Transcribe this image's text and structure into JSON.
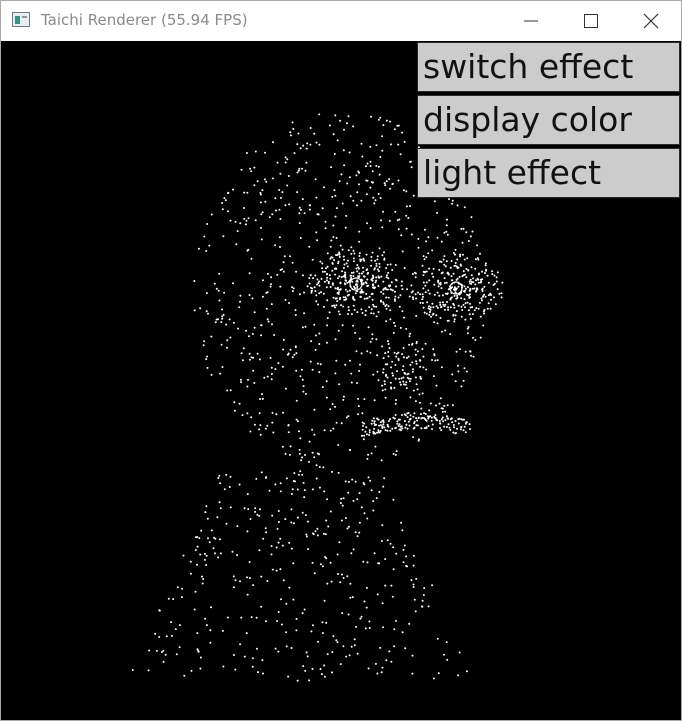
{
  "window": {
    "title": "Taichi Renderer (55.94 FPS)",
    "icon": "taichi-app-icon",
    "controls": [
      "minimize-icon",
      "maximize-icon",
      "close-icon"
    ]
  },
  "canvas": {
    "background": "#000000",
    "point_color": "#ffffff",
    "content": "point-cloud-face"
  },
  "menu": {
    "buttons": [
      {
        "label": "switch effect"
      },
      {
        "label": "display color"
      },
      {
        "label": "light effect"
      }
    ],
    "button_bg": "#cccccc"
  }
}
